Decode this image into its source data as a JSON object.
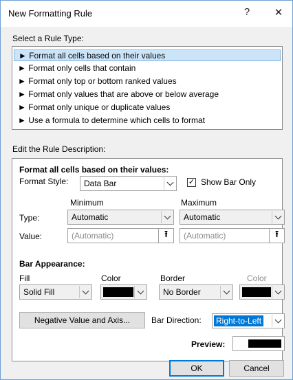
{
  "dialog": {
    "title": "New Formatting Rule",
    "help_glyph": "?",
    "close_glyph": "✕"
  },
  "rule_type": {
    "label": "Select a Rule Type:",
    "items": [
      "► Format all cells based on their values",
      "► Format only cells that contain",
      "► Format only top or bottom ranked values",
      "► Format only values that are above or below average",
      "► Format only unique or duplicate values",
      "► Use a formula to determine which cells to format"
    ],
    "selected_index": 0
  },
  "description": {
    "label": "Edit the Rule Description:",
    "heading": "Format all cells based on their values:",
    "format_style_label": "Format Style:",
    "format_style_value": "Data Bar",
    "show_bar_only_label": "Show Bar Only",
    "show_bar_only_checked": true,
    "minimum_label": "Minimum",
    "maximum_label": "Maximum",
    "type_label": "Type:",
    "min_type": "Automatic",
    "max_type": "Automatic",
    "value_label": "Value:",
    "min_value": "(Automatic)",
    "max_value": "(Automatic)",
    "bar_appearance_label": "Bar Appearance:",
    "fill_label": "Fill",
    "fill_value": "Solid Fill",
    "fill_color_label": "Color",
    "fill_color": "#000000",
    "border_label": "Border",
    "border_value": "No Border",
    "border_color_label": "Color",
    "border_color": "#000000",
    "negative_button": "Negative Value and Axis...",
    "bar_direction_label": "Bar Direction:",
    "bar_direction_value": "Right-to-Left",
    "preview_label": "Preview:"
  },
  "buttons": {
    "ok": "OK",
    "cancel": "Cancel"
  },
  "colors": {
    "selection_bg": "#cce4f7",
    "accent": "#0078d7"
  }
}
